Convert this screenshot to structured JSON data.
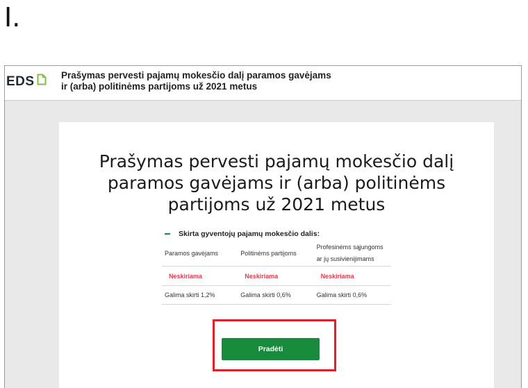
{
  "step_label": "I.",
  "header": {
    "logo_text": "EDS",
    "logo_icon": "document-icon",
    "title_line1": "Prašymas pervesti pajamų mokesčio dalį paramos gavėjams",
    "title_line2": "ir (arba) politinėms partijoms už 2021 metus"
  },
  "main": {
    "title_line1": "Prašymas pervesti pajamų mokesčio dalį",
    "title_line2": "paramos gavėjams ir (arba) politinėms",
    "title_line3": "partijoms už 2021 metus",
    "section_label": "Skirta gyventojų pajamų mokesčio dalis:",
    "table": {
      "headers": [
        "Paramos gavėjams",
        "Politinėms partijoms",
        "Profesinėms sąjungoms",
        "ar jų susivienijimams"
      ],
      "status": [
        "Neskiriama",
        "Neskiriama",
        "Neskiriama"
      ],
      "values": [
        "Galima skirti 1,2%",
        "Galima skirti 0,6%",
        "Galima skirti 0,6%"
      ]
    },
    "start_button": "Pradėti"
  },
  "colors": {
    "accent_green": "#188a3c",
    "status_red": "#e23b4a",
    "highlight_red": "#e0202a",
    "logo_icon_green": "#7cc242"
  }
}
